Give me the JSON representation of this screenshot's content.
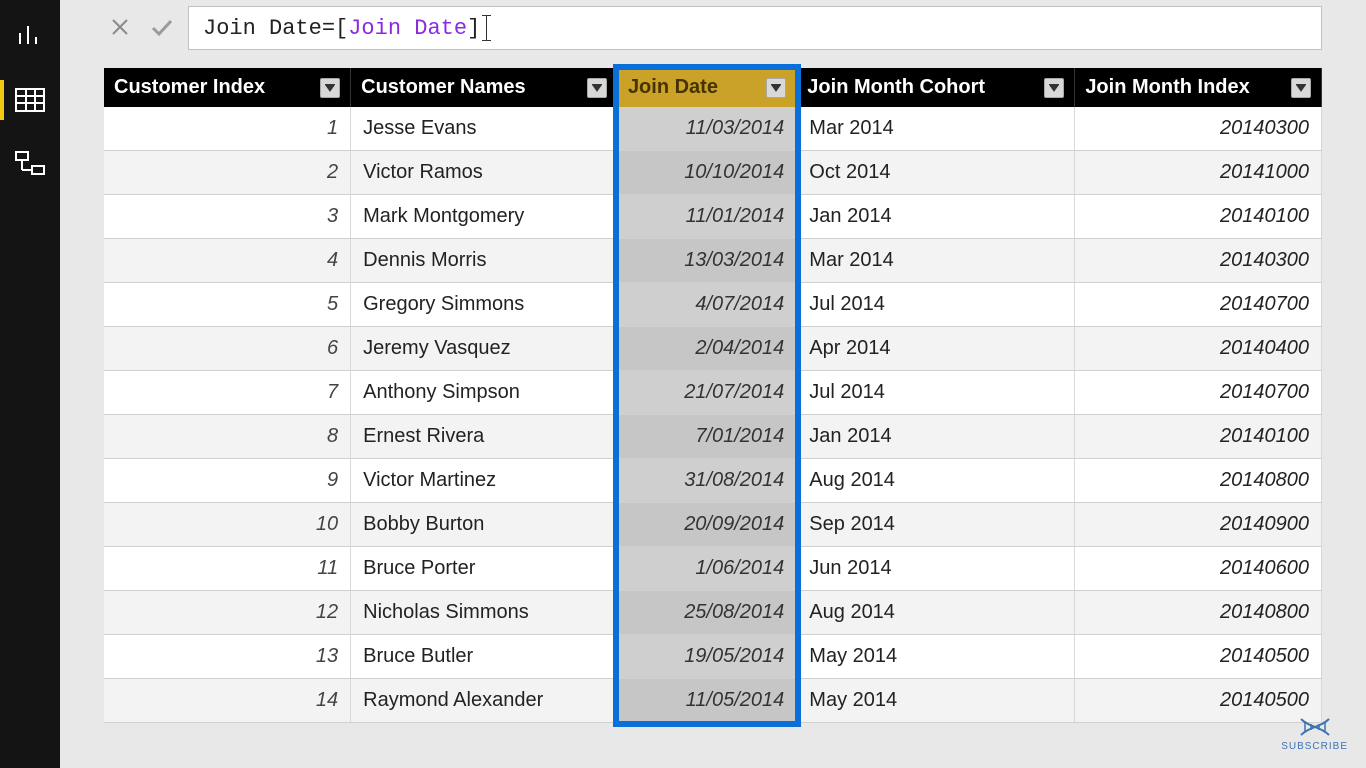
{
  "formula": {
    "lhs": "Join Date",
    "eq": " = ",
    "bracket_open": "[",
    "ref": "Join Date",
    "bracket_close": "]"
  },
  "columns": {
    "customer_index": "Customer Index",
    "customer_names": "Customer Names",
    "join_date": "Join Date",
    "join_month_cohort": "Join Month Cohort",
    "join_month_index": "Join Month Index"
  },
  "selected_column": "join_date",
  "rows": [
    {
      "idx": "1",
      "name": "Jesse Evans",
      "date": "11/03/2014",
      "cohort": "Mar 2014",
      "mindex": "20140300"
    },
    {
      "idx": "2",
      "name": "Victor Ramos",
      "date": "10/10/2014",
      "cohort": "Oct 2014",
      "mindex": "20141000"
    },
    {
      "idx": "3",
      "name": "Mark Montgomery",
      "date": "11/01/2014",
      "cohort": "Jan 2014",
      "mindex": "20140100"
    },
    {
      "idx": "4",
      "name": "Dennis Morris",
      "date": "13/03/2014",
      "cohort": "Mar 2014",
      "mindex": "20140300"
    },
    {
      "idx": "5",
      "name": "Gregory Simmons",
      "date": "4/07/2014",
      "cohort": "Jul 2014",
      "mindex": "20140700"
    },
    {
      "idx": "6",
      "name": "Jeremy Vasquez",
      "date": "2/04/2014",
      "cohort": "Apr 2014",
      "mindex": "20140400"
    },
    {
      "idx": "7",
      "name": "Anthony Simpson",
      "date": "21/07/2014",
      "cohort": "Jul 2014",
      "mindex": "20140700"
    },
    {
      "idx": "8",
      "name": "Ernest Rivera",
      "date": "7/01/2014",
      "cohort": "Jan 2014",
      "mindex": "20140100"
    },
    {
      "idx": "9",
      "name": "Victor Martinez",
      "date": "31/08/2014",
      "cohort": "Aug 2014",
      "mindex": "20140800"
    },
    {
      "idx": "10",
      "name": "Bobby Burton",
      "date": "20/09/2014",
      "cohort": "Sep 2014",
      "mindex": "20140900"
    },
    {
      "idx": "11",
      "name": "Bruce Porter",
      "date": "1/06/2014",
      "cohort": "Jun 2014",
      "mindex": "20140600"
    },
    {
      "idx": "12",
      "name": "Nicholas Simmons",
      "date": "25/08/2014",
      "cohort": "Aug 2014",
      "mindex": "20140800"
    },
    {
      "idx": "13",
      "name": "Bruce Butler",
      "date": "19/05/2014",
      "cohort": "May 2014",
      "mindex": "20140500"
    },
    {
      "idx": "14",
      "name": "Raymond Alexander",
      "date": "11/05/2014",
      "cohort": "May 2014",
      "mindex": "20140500"
    }
  ],
  "subscribe_label": "SUBSCRIBE"
}
